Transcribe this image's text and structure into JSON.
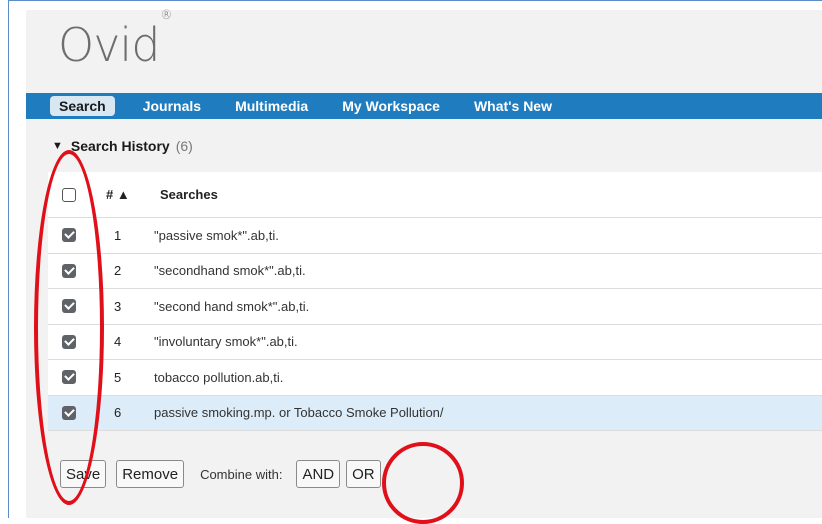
{
  "logo": {
    "text": "Ovid",
    "mark": "®"
  },
  "nav": {
    "items": [
      {
        "label": "Search",
        "active": true
      },
      {
        "label": "Journals",
        "active": false
      },
      {
        "label": "Multimedia",
        "active": false
      },
      {
        "label": "My Workspace",
        "active": false
      },
      {
        "label": "What's New",
        "active": false
      }
    ]
  },
  "history": {
    "title": "Search History",
    "count": "(6)",
    "columns": {
      "number": "# ▲",
      "searches": "Searches"
    },
    "rows": [
      {
        "num": "1",
        "query": "\"passive smok*\".ab,ti.",
        "checked": true
      },
      {
        "num": "2",
        "query": "\"secondhand smok*\".ab,ti.",
        "checked": true
      },
      {
        "num": "3",
        "query": "\"second hand smok*\".ab,ti.",
        "checked": true
      },
      {
        "num": "4",
        "query": "\"involuntary smok*\".ab,ti.",
        "checked": true
      },
      {
        "num": "5",
        "query": "tobacco pollution.ab,ti.",
        "checked": true
      },
      {
        "num": "6",
        "query": "passive smoking.mp. or Tobacco Smoke Pollution/",
        "checked": true
      }
    ]
  },
  "actions": {
    "save_label": "Save",
    "remove_label": "Remove",
    "combine_label": "Combine with:",
    "and_label": "AND",
    "or_label": "OR"
  },
  "colors": {
    "navbar": "#1f7dbf",
    "highlight_row": "#dcecf9",
    "annotation": "#e0101a"
  }
}
